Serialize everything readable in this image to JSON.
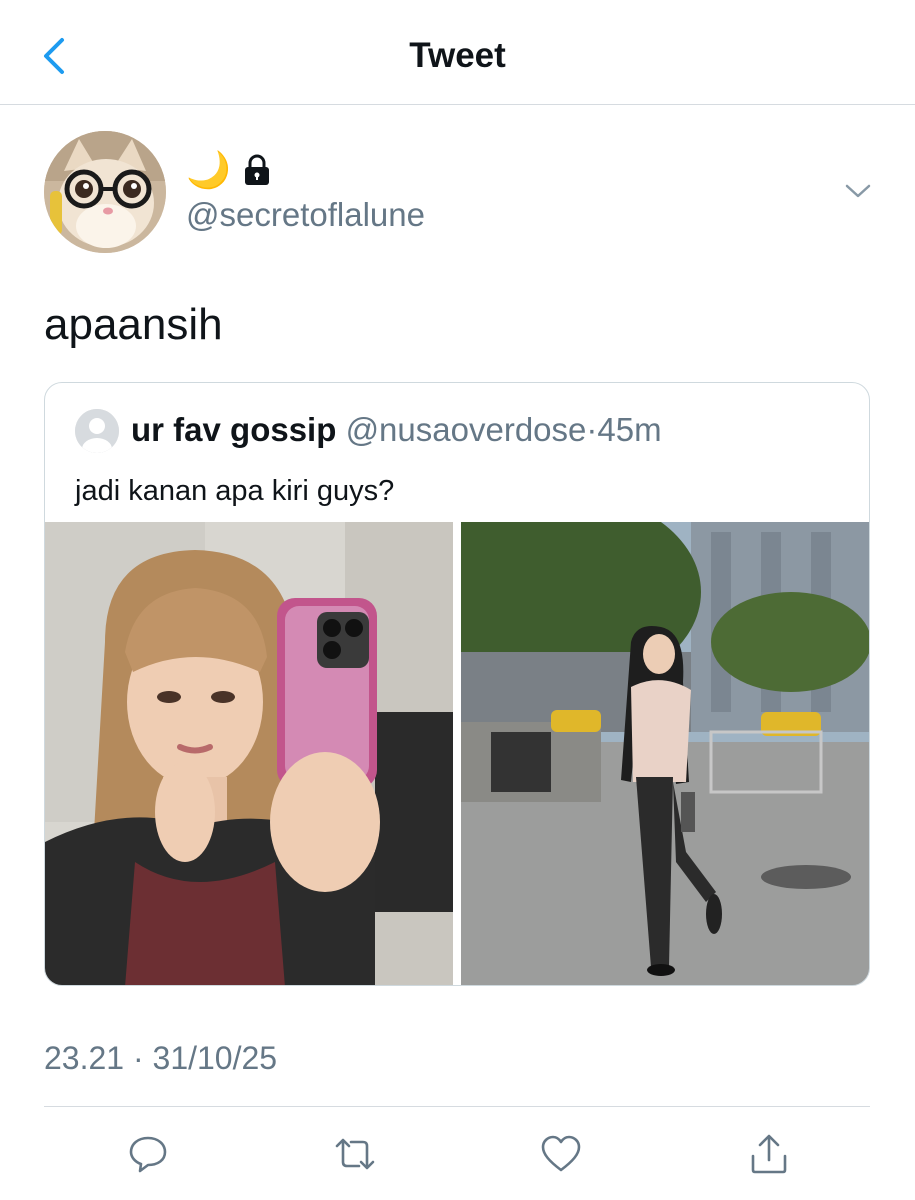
{
  "header": {
    "title": "Tweet",
    "back_icon": "chevron-left-icon"
  },
  "author": {
    "emoji": "🌙",
    "lock_icon": "lock-icon",
    "handle": "@secretoflalune",
    "menu_icon": "chevron-down-icon"
  },
  "tweet": {
    "text": "apaansih",
    "timestamp": "23.21 · 31/10/25"
  },
  "quoted": {
    "name": "ur fav gossip",
    "handle": "@nusaoverdose",
    "separator": "·",
    "time": "45m",
    "text": "jadi kanan apa kiri guys?"
  },
  "actions": [
    "reply-icon",
    "retweet-icon",
    "like-icon",
    "share-icon"
  ],
  "colors": {
    "accent": "#1d9bf0",
    "secondary_text": "#657786",
    "border": "#cfd9de"
  }
}
